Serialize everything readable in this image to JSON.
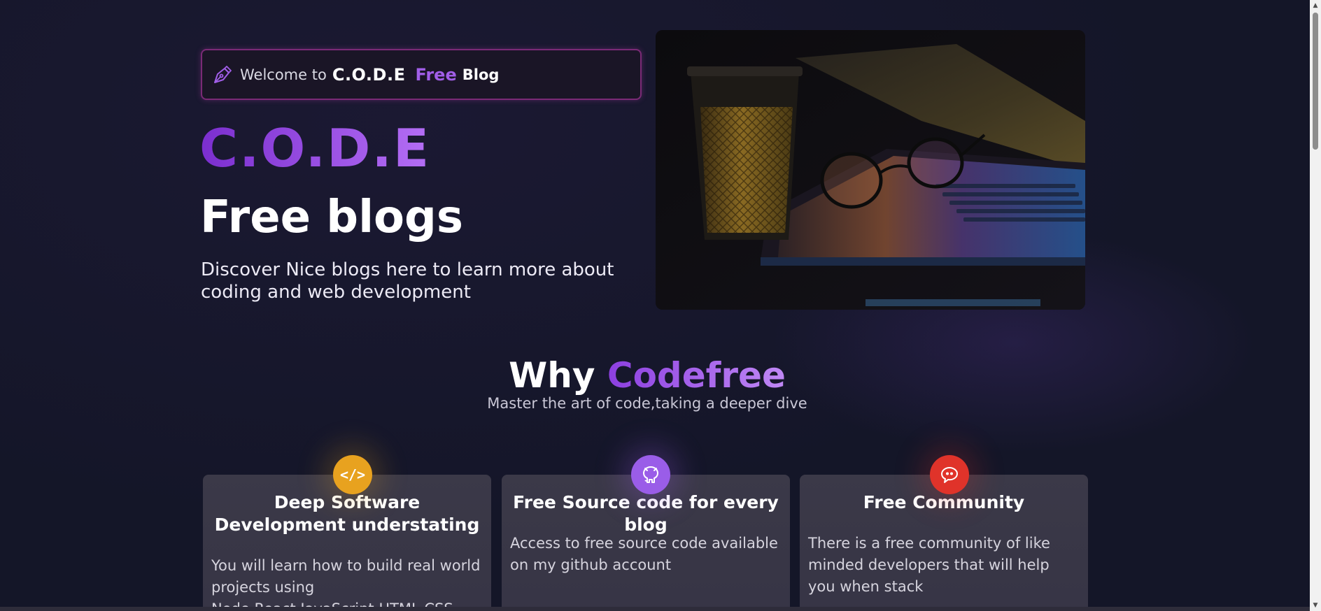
{
  "hero": {
    "welcome_text": "Welcome to",
    "welcome_brand": "C.O.D.E",
    "welcome_free": "Free",
    "welcome_blog": "Blog",
    "brand": "C.O.D.E",
    "title": "Free blogs",
    "description": "Discover Nice blogs here to learn more about coding and web development"
  },
  "why": {
    "title_word": "Why",
    "title_accent": "Codefree",
    "subtitle": "Master the art of code,taking a deeper dive"
  },
  "cards": [
    {
      "icon": "code-icon",
      "icon_glyph": "</>",
      "title": "Deep Software Development understating",
      "text": "You will learn how to build real world projects using Node,React,JavaScript,HTML,CSS",
      "color": "#e8a21f"
    },
    {
      "icon": "github-icon",
      "title": "Free Source code for every blog",
      "text": "Access to free source code available on my github account",
      "color": "#9a5de8"
    },
    {
      "icon": "chat-icon",
      "title": "Free Community",
      "text": "There is a free community of like minded developers that will help you when stack",
      "color": "#e0332a"
    }
  ],
  "colors": {
    "background": "#141628",
    "accent_purple": "#8f3fd8",
    "card_bg": "#3b3948"
  }
}
